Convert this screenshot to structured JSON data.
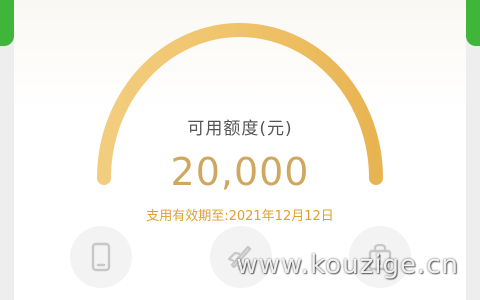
{
  "credit": {
    "label": "可用额度(元)",
    "amount": "20,000",
    "validity": "支用有效期至:2021年12月12日"
  },
  "actions": [
    {
      "icon": "phone-icon"
    },
    {
      "icon": "rocket-icon"
    },
    {
      "icon": "bag-icon"
    }
  ],
  "watermark": "www.kouzige.cn",
  "colors": {
    "accent_green": "#3fb53a",
    "gauge_gold": "#f0c36a",
    "amount_gold": "#cfa760",
    "validity_orange": "#e0a02c"
  }
}
